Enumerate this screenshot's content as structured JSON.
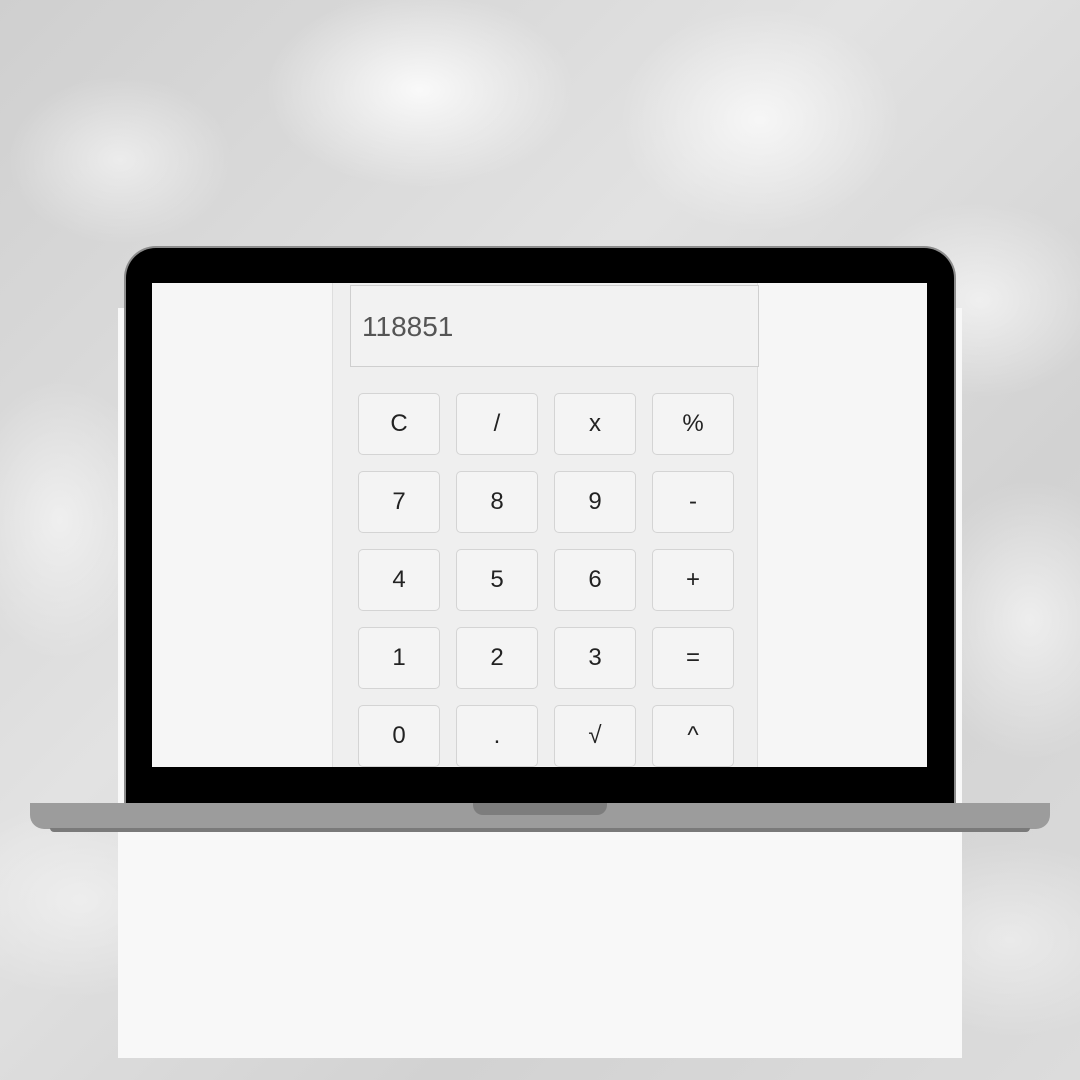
{
  "calculator": {
    "display_value": "118851",
    "keys": [
      {
        "label": "C",
        "name": "clear-button"
      },
      {
        "label": "/",
        "name": "divide-button"
      },
      {
        "label": "x",
        "name": "multiply-button"
      },
      {
        "label": "%",
        "name": "percent-button"
      },
      {
        "label": "7",
        "name": "digit-7-button"
      },
      {
        "label": "8",
        "name": "digit-8-button"
      },
      {
        "label": "9",
        "name": "digit-9-button"
      },
      {
        "label": "-",
        "name": "subtract-button"
      },
      {
        "label": "4",
        "name": "digit-4-button"
      },
      {
        "label": "5",
        "name": "digit-5-button"
      },
      {
        "label": "6",
        "name": "digit-6-button"
      },
      {
        "label": "+",
        "name": "add-button"
      },
      {
        "label": "1",
        "name": "digit-1-button"
      },
      {
        "label": "2",
        "name": "digit-2-button"
      },
      {
        "label": "3",
        "name": "digit-3-button"
      },
      {
        "label": "=",
        "name": "equals-button"
      },
      {
        "label": "0",
        "name": "digit-0-button"
      },
      {
        "label": ".",
        "name": "decimal-button"
      },
      {
        "label": "√",
        "name": "square-root-button"
      },
      {
        "label": "^",
        "name": "power-button"
      }
    ]
  }
}
